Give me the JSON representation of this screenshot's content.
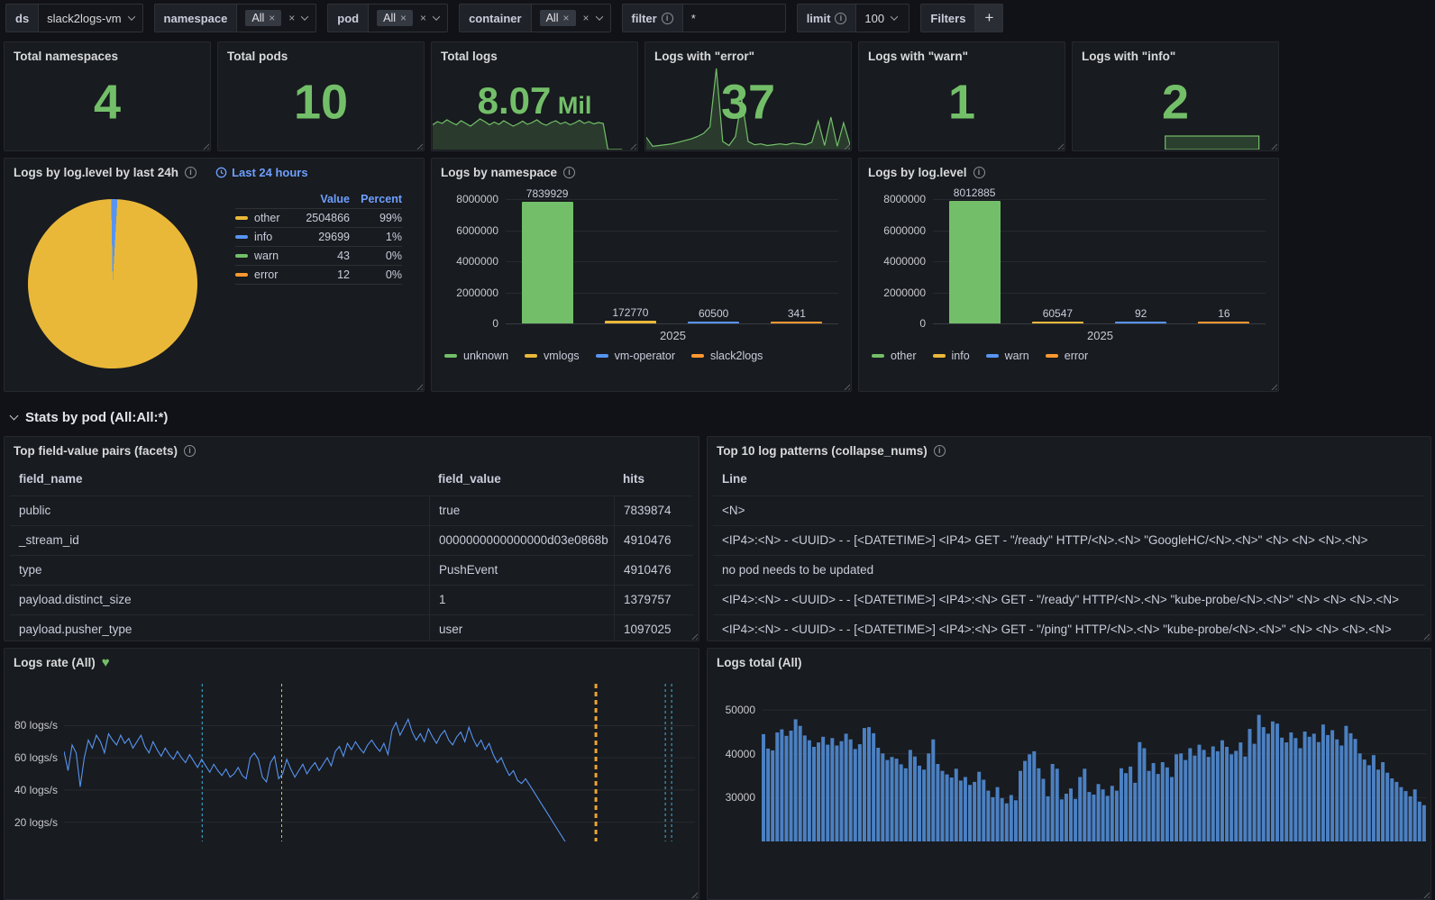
{
  "colors": {
    "green": "#73bf69",
    "yellow": "#eab839",
    "blue": "#5794f2",
    "orange": "#ff9830",
    "link": "#6e9fff",
    "bar_blue": "#4b80c2"
  },
  "toolbar": {
    "ds_label": "ds",
    "ds_value": "slack2logs-vm",
    "vars": [
      {
        "label": "namespace",
        "chip": "All"
      },
      {
        "label": "pod",
        "chip": "All"
      },
      {
        "label": "container",
        "chip": "All"
      }
    ],
    "filter_label": "filter",
    "filter_value": "*",
    "limit_label": "limit",
    "limit_value": "100",
    "filters_label": "Filters",
    "add_label": "+"
  },
  "stat_panels": [
    {
      "title": "Total namespaces",
      "value": "4",
      "suffix": ""
    },
    {
      "title": "Total pods",
      "value": "10",
      "suffix": ""
    },
    {
      "title": "Total logs",
      "value": "8.07",
      "suffix": " Mil",
      "spark": {
        "type": "area",
        "h": 52,
        "x_end": 0.93,
        "values": [
          0.55,
          0.62,
          0.58,
          0.66,
          0.6,
          0.55,
          0.64,
          0.58,
          0.52,
          0.6,
          0.68,
          0.62,
          0.55,
          0.61,
          0.56,
          0.64,
          0.58,
          0.52,
          0.57,
          0.63,
          0.56,
          0.6,
          0.66,
          0.58,
          0.54,
          0.6,
          0.64,
          0.57,
          0.61,
          0.55,
          0.59,
          0.65,
          0.58,
          0.62,
          0.57,
          0.6,
          0.58,
          0,
          0,
          0,
          0
        ]
      }
    },
    {
      "title": "Logs with \"error\"",
      "value": "37",
      "suffix": "",
      "spark": {
        "type": "area",
        "h": 92,
        "x_end": 1,
        "values": [
          0.15,
          0.04,
          0.05,
          0.06,
          0.07,
          0.09,
          0.11,
          0.13,
          0.16,
          0.2,
          0.28,
          1.0,
          0.1,
          0.05,
          0.16,
          0.62,
          0.1,
          0.06,
          0.07,
          0.05,
          0.06,
          0.07,
          0.06,
          0.08,
          0.07,
          0.06,
          0.09,
          0.35,
          0.05,
          0.4,
          0.04,
          0.33,
          0.06
        ]
      }
    },
    {
      "title": "Logs with \"warn\"",
      "value": "1",
      "suffix": ""
    },
    {
      "title": "Logs with \"info\"",
      "value": "2",
      "suffix": "",
      "spark": {
        "type": "block",
        "h": 16,
        "from": 0.45,
        "to": 0.91
      }
    }
  ],
  "pie_panel": {
    "title": "Logs by log.level by last 24h",
    "time_label": "Last 24 hours",
    "legend_headers": {
      "value": "Value",
      "percent": "Percent"
    },
    "legend_rows": [
      {
        "label": "other",
        "value": "2504866",
        "percent": "99%",
        "color": "#eab839"
      },
      {
        "label": "info",
        "value": "29699",
        "percent": "1%",
        "color": "#5794f2"
      },
      {
        "label": "warn",
        "value": "43",
        "percent": "0%",
        "color": "#73bf69"
      },
      {
        "label": "error",
        "value": "12",
        "percent": "0%",
        "color": "#ff9830"
      }
    ],
    "chart_data": {
      "type": "pie",
      "labels": [
        "other",
        "info",
        "warn",
        "error"
      ],
      "values": [
        2504866,
        29699,
        43,
        12
      ],
      "percents": [
        99,
        1,
        0,
        0
      ],
      "colors": [
        "#eab839",
        "#5794f2",
        "#73bf69",
        "#ff9830"
      ],
      "draw_order": [
        1,
        0,
        2,
        3
      ],
      "start_deg": -1
    }
  },
  "namespace_panel": {
    "title": "Logs by namespace",
    "xlabel": "2025",
    "chart_data": {
      "type": "bar",
      "categories": [
        "unknown",
        "vmlogs",
        "vm-operator",
        "slack2logs"
      ],
      "values": [
        7839929,
        172770,
        60500,
        341
      ],
      "colors": [
        "#73bf69",
        "#eab839",
        "#5794f2",
        "#ff9830"
      ],
      "ymax": 8000000,
      "yticks": [
        8000000,
        6000000,
        4000000,
        2000000,
        0
      ],
      "xlabel": "2025"
    }
  },
  "level_panel": {
    "title": "Logs by log.level",
    "xlabel": "2025",
    "chart_data": {
      "type": "bar",
      "categories": [
        "other",
        "info",
        "warn",
        "error"
      ],
      "values": [
        8012885,
        60547,
        92,
        16
      ],
      "colors": [
        "#73bf69",
        "#eab839",
        "#5794f2",
        "#ff9830"
      ],
      "ymax": 8000000,
      "yticks": [
        8000000,
        6000000,
        4000000,
        2000000,
        0
      ],
      "xlabel": "2025"
    }
  },
  "section": {
    "title": "Stats by pod (All:All:*)"
  },
  "facets_panel": {
    "title": "Top field-value pairs (facets)",
    "columns": [
      "field_name",
      "field_value",
      "hits"
    ],
    "rows": [
      [
        "public",
        "true",
        "7839874"
      ],
      [
        "_stream_id",
        "0000000000000000d03e0868b",
        "4910476"
      ],
      [
        "type",
        "PushEvent",
        "4910476"
      ],
      [
        "payload.distinct_size",
        "1",
        "1379757"
      ],
      [
        "payload.pusher_type",
        "user",
        "1097025"
      ]
    ]
  },
  "patterns_panel": {
    "title": "Top 10 log patterns (collapse_nums)",
    "column": "Line",
    "rows": [
      "<N>",
      "<IP4>:<N> - <UUID> - - [<DATETIME>] <IP4> GET - \"/ready\" HTTP/<N>.<N> \"GoogleHC/<N>.<N>\" <N> <N> <N>.<N>",
      "no pod needs to be updated",
      "<IP4>:<N> - <UUID> - - [<DATETIME>] <IP4>:<N> GET - \"/ready\" HTTP/<N>.<N> \"kube-probe/<N>.<N>\" <N> <N> <N>.<N>",
      "<IP4>:<N> - <UUID> - - [<DATETIME>] <IP4>:<N> GET - \"/ping\" HTTP/<N>.<N> \"kube-probe/<N>.<N>\" <N> <N> <N>.<N>"
    ]
  },
  "rate_panel": {
    "title": "Logs rate (All)",
    "chart_data": {
      "type": "line",
      "ylabel": "logs/s",
      "ylim": [
        8,
        106
      ],
      "x_end": 0.815,
      "yticks": [
        {
          "v": 80,
          "label": "80 logs/s"
        },
        {
          "v": 60,
          "label": "60 logs/s"
        },
        {
          "v": 40,
          "label": "40 logs/s"
        },
        {
          "v": 20,
          "label": "20 logs/s"
        }
      ],
      "line_color": "#5794f2",
      "annotations": [
        {
          "x": 0.219,
          "color": "#3fb5e0",
          "w": 1
        },
        {
          "x": 0.345,
          "color": "#e8c70c",
          "w": 1
        },
        {
          "x": 0.843,
          "color": "#f0a32e",
          "w": 3
        },
        {
          "x": 0.953,
          "color": "#3fb5e0",
          "w": 1
        },
        {
          "x": 0.963,
          "color": "#3fb5e0",
          "w": 1
        }
      ],
      "values": [
        64,
        52,
        68,
        63,
        42,
        60,
        71,
        66,
        74,
        70,
        63,
        75,
        71,
        68,
        74,
        69,
        72,
        66,
        70,
        74,
        67,
        63,
        70,
        65,
        61,
        66,
        62,
        59,
        64,
        60,
        57,
        62,
        58,
        54,
        59,
        55,
        51,
        56,
        52,
        49,
        53,
        48,
        50,
        54,
        49,
        47,
        60,
        63,
        59,
        48,
        45,
        57,
        61,
        47,
        50,
        59,
        53,
        48,
        52,
        56,
        50,
        54,
        57,
        52,
        56,
        60,
        55,
        64,
        67,
        61,
        69,
        65,
        70,
        66,
        63,
        68,
        71,
        67,
        64,
        69,
        62,
        77,
        82,
        74,
        79,
        84,
        76,
        71,
        75,
        70,
        78,
        73,
        69,
        74,
        77,
        71,
        68,
        73,
        76,
        70,
        79,
        72,
        67,
        71,
        65,
        69,
        62,
        57,
        60,
        54,
        49,
        52,
        46,
        44,
        47,
        43,
        39,
        35,
        31,
        27,
        23,
        19,
        15,
        11,
        7,
        3,
        -1,
        -5
      ]
    }
  },
  "total_panel": {
    "title": "Logs total (All)",
    "chart_data": {
      "type": "bar",
      "ylim": [
        20000,
        56000
      ],
      "yticks": [
        {
          "v": 50000,
          "label": "50000"
        },
        {
          "v": 40000,
          "label": "40000"
        },
        {
          "v": 30000,
          "label": "30000"
        }
      ],
      "bar_color": "#4b80c2",
      "values": [
        44500,
        41200,
        40800,
        44900,
        45600,
        44100,
        45300,
        47900,
        46400,
        44200,
        43100,
        41600,
        42600,
        43900,
        42100,
        43600,
        41900,
        42900,
        44600,
        43300,
        41100,
        42200,
        45900,
        46100,
        44700,
        41400,
        40100,
        38600,
        39300,
        38900,
        37600,
        36700,
        40900,
        39400,
        37300,
        36400,
        40100,
        43300,
        37700,
        36100,
        35300,
        34600,
        36600,
        33900,
        34700,
        32900,
        33600,
        35900,
        34100,
        31600,
        30100,
        32400,
        29900,
        28700,
        30600,
        29400,
        36100,
        38400,
        39900,
        40600,
        36700,
        34300,
        30300,
        37700,
        36600,
        29600,
        30900,
        32100,
        29700,
        34700,
        36600,
        31300,
        30700,
        33100,
        31900,
        30400,
        32700,
        31600,
        36700,
        35600,
        37100,
        33400,
        42700,
        41300,
        36100,
        37900,
        35400,
        38100,
        36900,
        34700,
        39900,
        40100,
        38600,
        41300,
        39600,
        42100,
        40900,
        39300,
        41700,
        40600,
        43100,
        41600,
        39900,
        40700,
        42600,
        39400,
        45700,
        42300,
        48900,
        46100,
        44600,
        47400,
        46900,
        43700,
        42600,
        44900,
        43600,
        41300,
        45100,
        43900,
        44600,
        42700,
        46700,
        44300,
        45400,
        43300,
        41900,
        46400,
        44700,
        43400,
        40100,
        38700,
        37400,
        39700,
        36400,
        38100,
        35700,
        34400,
        33600,
        32400,
        31500,
        30300,
        31900,
        29100,
        28300
      ]
    }
  }
}
